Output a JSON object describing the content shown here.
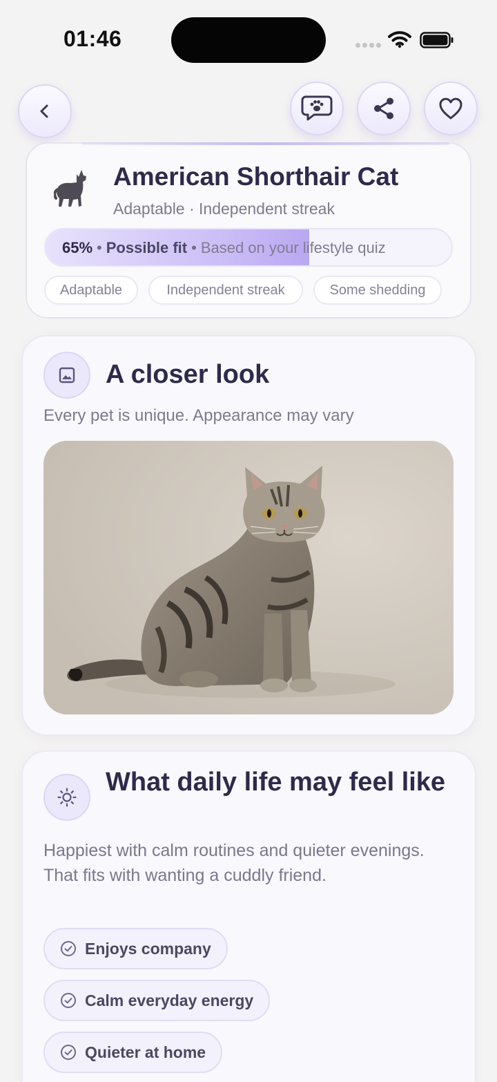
{
  "status_bar": {
    "time": "01:46"
  },
  "icons": {
    "back": "chevron-left-icon",
    "chat": "chat-paw-icon",
    "share": "share-icon",
    "favorite": "heart-icon",
    "breed": "cat-silhouette-icon",
    "gallery": "image-icon",
    "daily_life": "sun-icon",
    "trait": "check-circle-icon"
  },
  "header": {
    "title": "American Shorthair Cat",
    "subtitle": "Adaptable · Independent streak",
    "fit": {
      "percent_label": "65%",
      "percent_value": 0.65,
      "label": "Possible fit",
      "basis": "Based on your lifestyle quiz"
    },
    "chips": [
      "Adaptable",
      "Independent streak",
      "Some shedding"
    ]
  },
  "closer_look": {
    "title": "A closer look",
    "subtitle": "Every pet is unique. Appearance may vary"
  },
  "daily_life": {
    "title": "What daily life may feel like",
    "body": "Happiest with calm routines and quieter evenings. That fits with wanting a cuddly friend.",
    "traits": [
      "Enjoys company",
      "Calm everyday energy",
      "Quieter at home"
    ]
  },
  "colors": {
    "accent": "#b9a7f1",
    "title": "#2e2a4b",
    "muted": "#7e7a8d",
    "background": "#f4f3f3"
  }
}
